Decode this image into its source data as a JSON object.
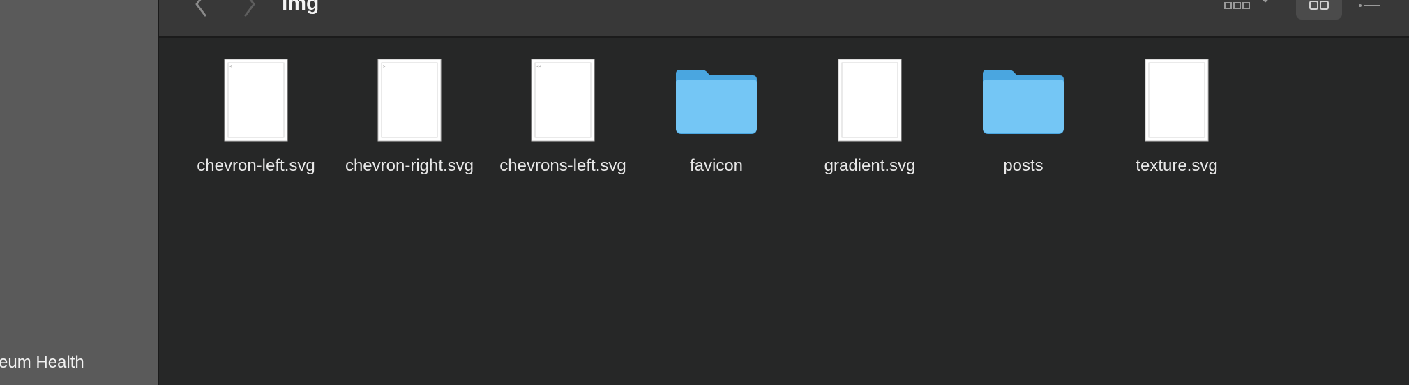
{
  "window": {
    "title": "img"
  },
  "sidebar": {
    "items": [
      {
        "label": "ceum Health"
      }
    ]
  },
  "toolbar": {
    "back_icon": "chevron-left-icon",
    "forward_icon": "chevron-right-icon",
    "group_icon": "grid-group-icon",
    "icon_view_icon": "icon-view-icon",
    "list_view_icon": "list-view-icon"
  },
  "files": [
    {
      "name": "chevron-left.svg",
      "kind": "document"
    },
    {
      "name": "chevron-right.svg",
      "kind": "document"
    },
    {
      "name": "chevrons-left.svg",
      "kind": "document"
    },
    {
      "name": "favicon",
      "kind": "folder"
    },
    {
      "name": "gradient.svg",
      "kind": "document"
    },
    {
      "name": "posts",
      "kind": "folder"
    },
    {
      "name": "texture.svg",
      "kind": "document"
    }
  ],
  "colors": {
    "folder": "#6ec3f4",
    "folder_tab": "#4aa6e0",
    "sidebar": "#5a5a5a",
    "toolbar": "#383838",
    "content": "#262727"
  }
}
